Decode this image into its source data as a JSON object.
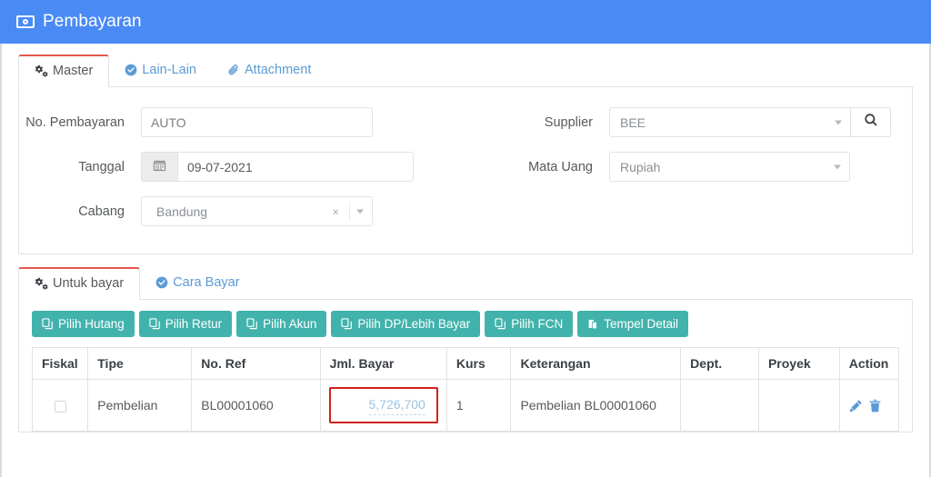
{
  "header": {
    "title": "Pembayaran",
    "icon": "money-bill-icon",
    "bg_color": "#4a8af4"
  },
  "master_tabs": {
    "items": [
      {
        "label": "Master",
        "icon": "cogs-icon",
        "active": true
      },
      {
        "label": "Lain-Lain",
        "icon": "check-circle-icon",
        "active": false
      },
      {
        "label": "Attachment",
        "icon": "paperclip-icon",
        "active": false
      }
    ]
  },
  "form": {
    "no_pembayaran": {
      "label": "No. Pembayaran",
      "value": "AUTO"
    },
    "tanggal": {
      "label": "Tanggal",
      "value": "09-07-2021",
      "icon": "calendar-icon"
    },
    "cabang": {
      "label": "Cabang",
      "value": "Bandung",
      "clear_label": "×"
    },
    "supplier": {
      "label": "Supplier",
      "value": "BEE",
      "search_icon": "search-icon"
    },
    "mata_uang": {
      "label": "Mata Uang",
      "value": "Rupiah"
    }
  },
  "detail_tabs": {
    "items": [
      {
        "label": "Untuk bayar",
        "icon": "cogs-icon",
        "active": true
      },
      {
        "label": "Cara Bayar",
        "icon": "check-circle-icon",
        "active": false
      }
    ]
  },
  "toolbar": {
    "color": "#42b3ac",
    "buttons": [
      {
        "label": "Pilih Hutang",
        "icon": "copy-icon"
      },
      {
        "label": "Pilih Retur",
        "icon": "copy-icon"
      },
      {
        "label": "Pilih Akun",
        "icon": "copy-icon"
      },
      {
        "label": "Pilih DP/Lebih Bayar",
        "icon": "copy-icon"
      },
      {
        "label": "Pilih FCN",
        "icon": "copy-icon"
      },
      {
        "label": "Tempel Detail",
        "icon": "paste-icon"
      }
    ]
  },
  "table": {
    "columns": [
      "Fiskal",
      "Tipe",
      "No. Ref",
      "Jml. Bayar",
      "Kurs",
      "Keterangan",
      "Dept.",
      "Proyek",
      "Action"
    ],
    "rows": [
      {
        "fiskal_checked": false,
        "tipe": "Pembelian",
        "no_ref": "BL00001060",
        "jml_bayar": "5,726,700",
        "jml_bayar_highlighted": true,
        "highlight_color": "#d0211c",
        "kurs": "1",
        "keterangan": "Pembelian BL00001060",
        "dept": "",
        "proyek": "",
        "actions": [
          "edit-icon",
          "delete-icon"
        ]
      }
    ]
  }
}
